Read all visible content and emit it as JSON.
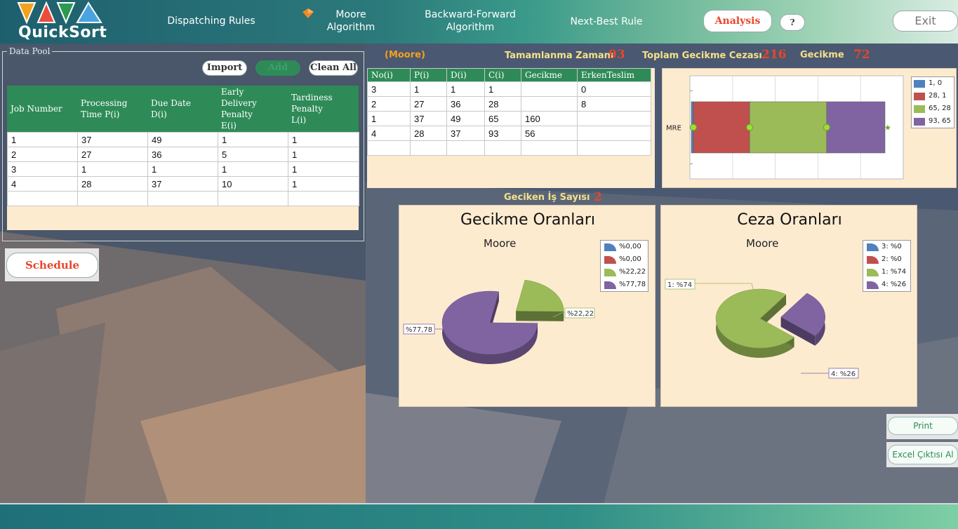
{
  "app": {
    "title": "QuickSort"
  },
  "nav": {
    "dispatching": "Dispatching Rules",
    "moore_1": "Moore",
    "moore_2": "Algorithm",
    "bf_1": "Backward-Forward",
    "bf_2": "Algorithm",
    "nbr": "Next-Best Rule",
    "analysis": "Analysis",
    "help": "?",
    "exit": "Exit"
  },
  "datapool": {
    "label": "Data Pool",
    "import": "Import",
    "add": "Add",
    "clean_all": "Clean All",
    "headers": [
      [
        "Job Number"
      ],
      [
        "Processing",
        "Time P(i)"
      ],
      [
        "Due Date",
        "D(i)"
      ],
      [
        "Early",
        "Delivery",
        "Penalty",
        "E(i)"
      ],
      [
        "Tardiness",
        "Penalty",
        "L(i)"
      ]
    ],
    "rows": [
      [
        "1",
        "37",
        "49",
        "1",
        "1"
      ],
      [
        "2",
        "27",
        "36",
        "5",
        "1"
      ],
      [
        "3",
        "1",
        "1",
        "1",
        "1"
      ],
      [
        "4",
        "28",
        "37",
        "10",
        "1"
      ],
      [
        "",
        "",
        "",
        "",
        ""
      ]
    ]
  },
  "schedule": "Schedule",
  "stats": {
    "algo": "(Moore)",
    "completion_label": "Tamamlanma Zamanı",
    "completion_val": "93",
    "penalty_label": "Toplam Gecikme Cezası",
    "penalty_val": "216",
    "tardiness_label": "Gecikme",
    "tardiness_val": "72",
    "late_jobs_label": "Geciken İş Sayısı",
    "late_jobs_val": "2"
  },
  "result_table": {
    "headers": [
      "No(i)",
      "P(i)",
      "D(i)",
      "C(i)",
      "Gecikme",
      "ErkenTeslim"
    ],
    "rows": [
      [
        "3",
        "1",
        "1",
        "1",
        "",
        "0"
      ],
      [
        "2",
        "27",
        "36",
        "28",
        "",
        "8"
      ],
      [
        "1",
        "37",
        "49",
        "65",
        "160",
        ""
      ],
      [
        "4",
        "28",
        "37",
        "93",
        "56",
        ""
      ],
      [
        "",
        "",
        "",
        "",
        "",
        ""
      ]
    ]
  },
  "chart_data": [
    {
      "type": "bar",
      "orientation": "horizontal-stacked",
      "categories": [
        "MRE"
      ],
      "series": [
        {
          "name": "1, 0",
          "start": 0,
          "end": 1,
          "color": "#4f81bd"
        },
        {
          "name": "28, 1",
          "start": 1,
          "end": 28,
          "color": "#c0504d"
        },
        {
          "name": "65, 28",
          "start": 28,
          "end": 65,
          "color": "#9bbb59"
        },
        {
          "name": "93, 65",
          "start": 65,
          "end": 93,
          "color": "#8064a2"
        }
      ],
      "legend": "right"
    },
    {
      "type": "pie",
      "title": "Gecikme Oranları",
      "subtitle": "Moore",
      "slices": [
        {
          "label": "%0,00",
          "value": 0,
          "color": "#4f81bd"
        },
        {
          "label": "%0,00",
          "value": 0,
          "color": "#c0504d"
        },
        {
          "label": "%22,22",
          "value": 22.22,
          "color": "#9bbb59"
        },
        {
          "label": "%77,78",
          "value": 77.78,
          "color": "#8064a2"
        }
      ],
      "data_labels": [
        "%22,22",
        "%77,78"
      ],
      "legend": "top-right"
    },
    {
      "type": "pie",
      "title": "Ceza Oranları",
      "subtitle": "Moore",
      "slices": [
        {
          "label": "3: %0",
          "value": 0,
          "color": "#4f81bd"
        },
        {
          "label": "2: %0",
          "value": 0,
          "color": "#c0504d"
        },
        {
          "label": "1: %74",
          "value": 74,
          "color": "#9bbb59"
        },
        {
          "label": "4: %26",
          "value": 26,
          "color": "#8064a2"
        }
      ],
      "data_labels": [
        "1: %74",
        "4: %26"
      ],
      "legend": "top-right"
    }
  ],
  "print": "Print",
  "excel": "Excel Çıktısı Al",
  "colors": {
    "green_header": "#2e8b57",
    "accent_red": "#e8462a",
    "stat_yellow": "#f6e08a",
    "card_bg": "#fdebd0"
  }
}
